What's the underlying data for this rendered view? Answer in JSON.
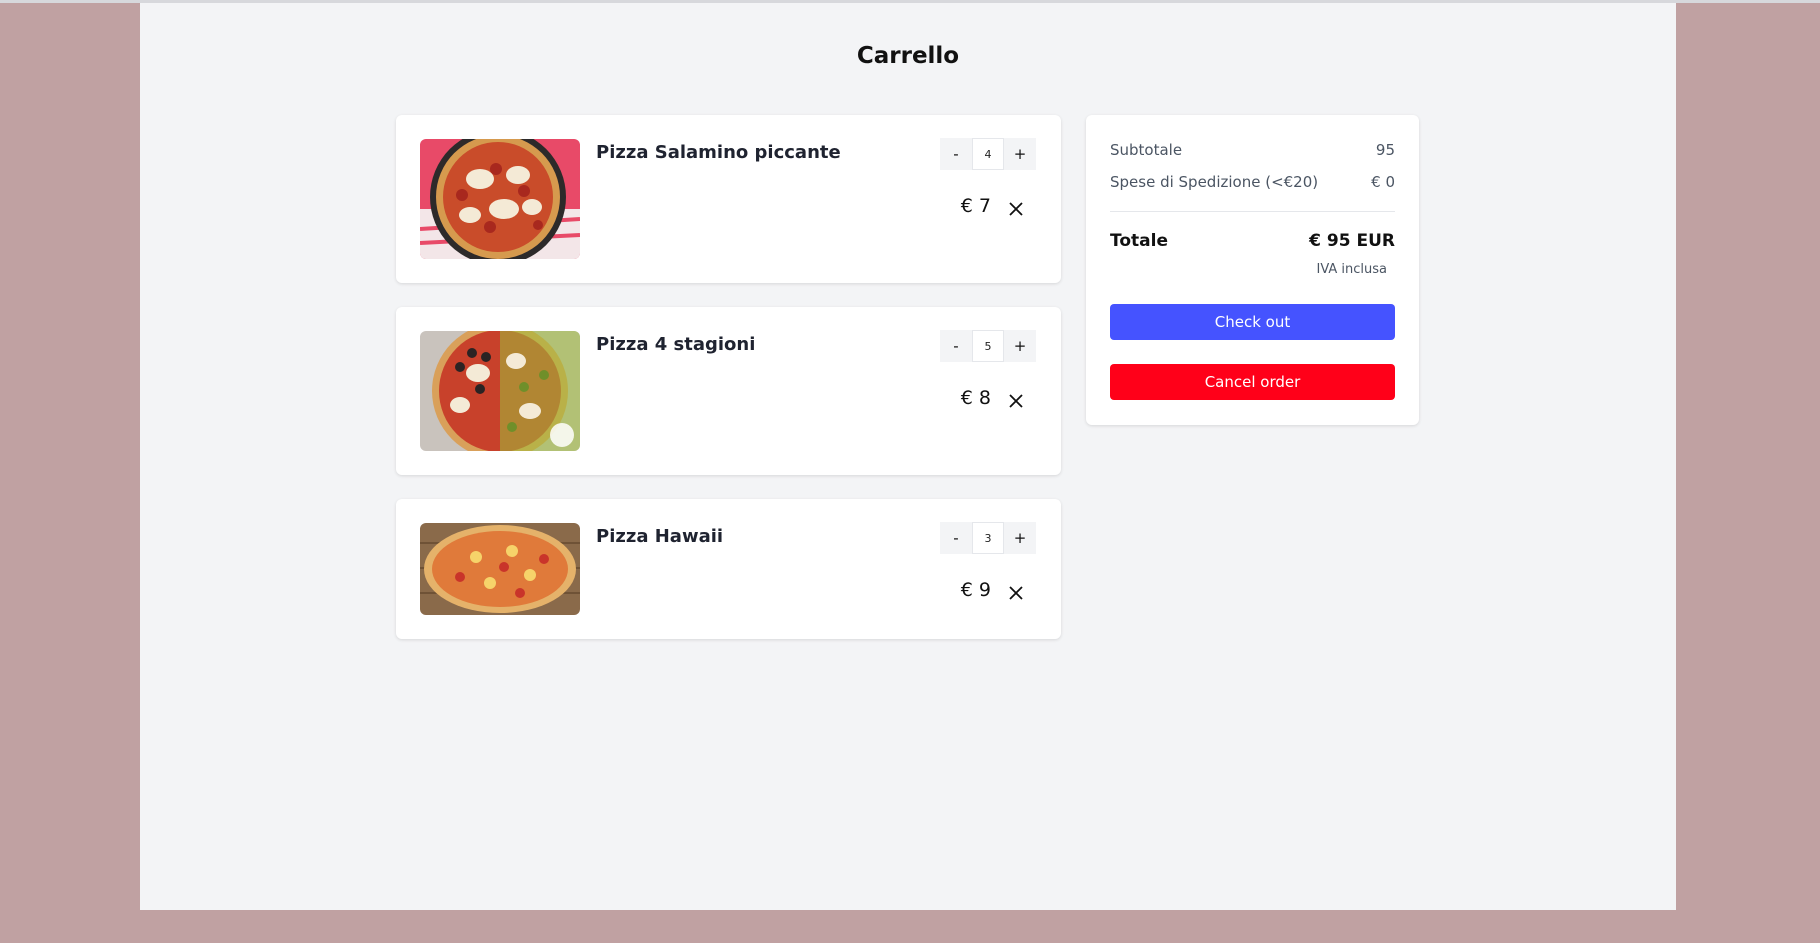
{
  "page": {
    "title": "Carrello"
  },
  "items": [
    {
      "name": "Pizza Salamino piccante",
      "quantity": "4",
      "price": "€ 7",
      "minus": "-",
      "plus": "+",
      "image": "pizza-salamino-photo"
    },
    {
      "name": "Pizza 4 stagioni",
      "quantity": "5",
      "price": "€ 8",
      "minus": "-",
      "plus": "+",
      "image": "pizza-4-stagioni-photo"
    },
    {
      "name": "Pizza Hawaii",
      "quantity": "3",
      "price": "€ 9",
      "minus": "-",
      "plus": "+",
      "image": "pizza-hawaii-photo"
    }
  ],
  "summary": {
    "subtotal_label": "Subtotale",
    "subtotal_value": "95",
    "shipping_label": "Spese di Spedizione (<€20)",
    "shipping_value": "€ 0",
    "total_label": "Totale",
    "total_value": "€ 95 EUR",
    "vat_note": "IVA inclusa",
    "checkout_label": "Check out",
    "cancel_label": "Cancel order"
  },
  "colors": {
    "outer_background": "#c0a1a2",
    "page_background": "#f3f4f6",
    "checkout_button": "#4553ff",
    "cancel_button": "#ff0019"
  }
}
